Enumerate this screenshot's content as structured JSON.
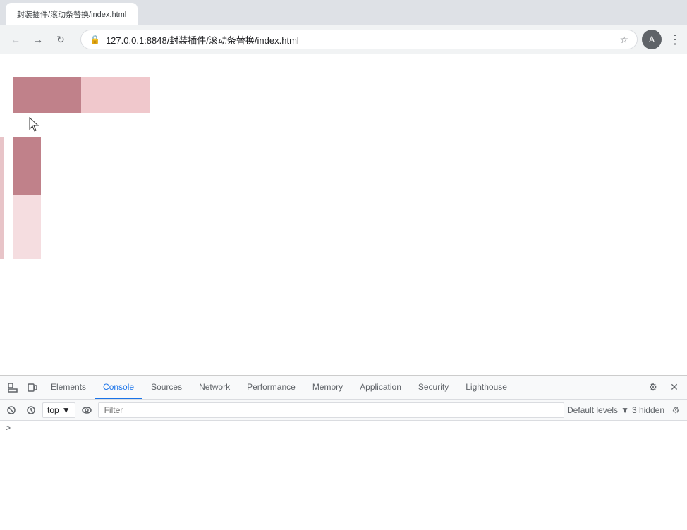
{
  "browser": {
    "back_button": "←",
    "forward_button": "→",
    "refresh_button": "↻",
    "url": "127.0.0.1:8848/封装插件/滚动条替换/index.html",
    "full_url": "127.0.0.1:8848/封装插件/滚动条替换/index.html",
    "star_icon": "☆",
    "profile_icon": "A",
    "menu_icon": "⋮",
    "tab_title": "封装插件/滚动条替换/index.html"
  },
  "devtools": {
    "tabs": [
      {
        "label": "Elements",
        "active": false
      },
      {
        "label": "Console",
        "active": true
      },
      {
        "label": "Sources",
        "active": false
      },
      {
        "label": "Network",
        "active": false
      },
      {
        "label": "Performance",
        "active": false
      },
      {
        "label": "Memory",
        "active": false
      },
      {
        "label": "Application",
        "active": false
      },
      {
        "label": "Security",
        "active": false
      },
      {
        "label": "Lighthouse",
        "active": false
      }
    ],
    "context": "top",
    "filter_placeholder": "Filter",
    "levels_label": "Default levels",
    "hidden_count": "3 hidden",
    "gear_icon": "⚙",
    "close_icon": "✕",
    "console_prompt": ">"
  },
  "page": {
    "box1_color": "#c0818a",
    "box2_color": "#f0c8cc",
    "strip_dark_color": "#c0818a",
    "strip_light_color": "#f5dde0"
  }
}
